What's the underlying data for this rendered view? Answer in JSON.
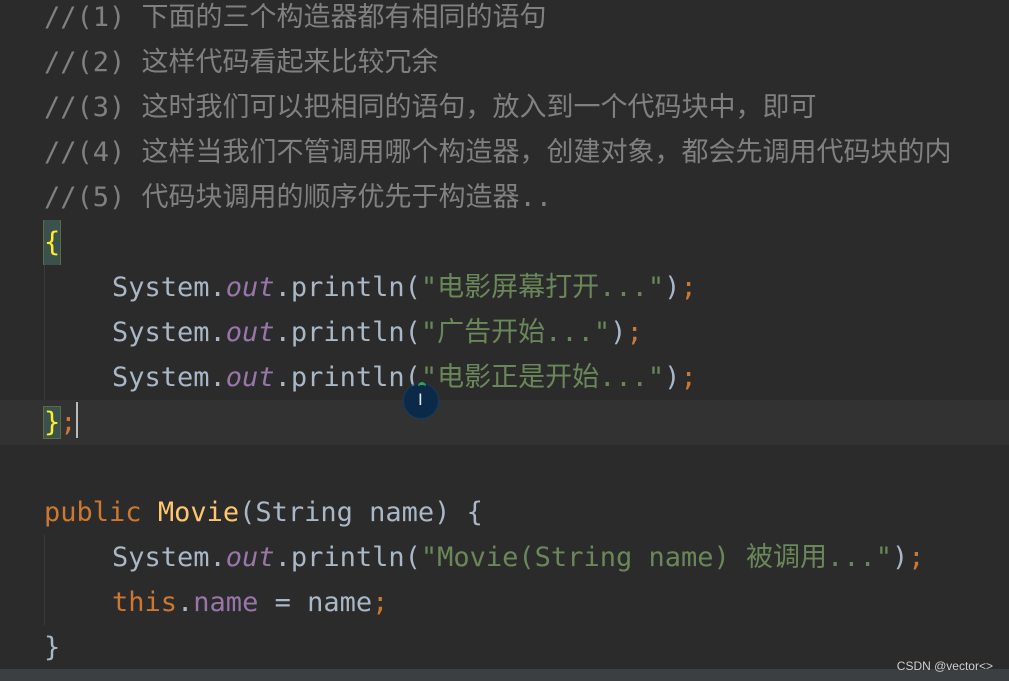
{
  "comments": [
    "//(1) 下面的三个构造器都有相同的语句",
    "//(2) 这样代码看起来比较冗余",
    "//(3) 这时我们可以把相同的语句，放入到一个代码块中，即可",
    "//(4) 这样当我们不管调用哪个构造器，创建对象，都会先调用代码块的内",
    "//(5) 代码块调用的顺序优先于构造器.."
  ],
  "code_block": {
    "open_brace": "{",
    "close_brace": "}",
    "close_semi": ";",
    "statements": [
      {
        "recv": "System.",
        "field": "out",
        "call": ".println(",
        "str": "\"电影屏幕打开...\"",
        "close": ")",
        "semi": ";"
      },
      {
        "recv": "System.",
        "field": "out",
        "call": ".println(",
        "str": "\"广告开始...\"",
        "close": ")",
        "semi": ";"
      },
      {
        "recv": "System.",
        "field": "out",
        "call": ".println(",
        "str": "\"电影正是开始...\"",
        "close": ")",
        "semi": ";"
      }
    ]
  },
  "constructor": {
    "modifier": "public",
    "name": "Movie",
    "params": "(String name) {",
    "stmt1": {
      "recv": "System.",
      "field": "out",
      "call": ".println(",
      "str": "\"Movie(String name) 被调用...\"",
      "close": ")",
      "semi": ";"
    },
    "stmt2": {
      "kw": "this",
      "dot": ".",
      "field": "name",
      "rest": " = name",
      "semi": ";"
    },
    "close_brace": "}"
  },
  "watermark": "CSDN @vector<>",
  "colors": {
    "background": "#2b2b2b",
    "comment": "#808080",
    "string": "#6a8759",
    "keyword": "#cc7832",
    "field": "#9876aa",
    "method_decl": "#ffc66d",
    "plain": "#a9b7c6"
  }
}
